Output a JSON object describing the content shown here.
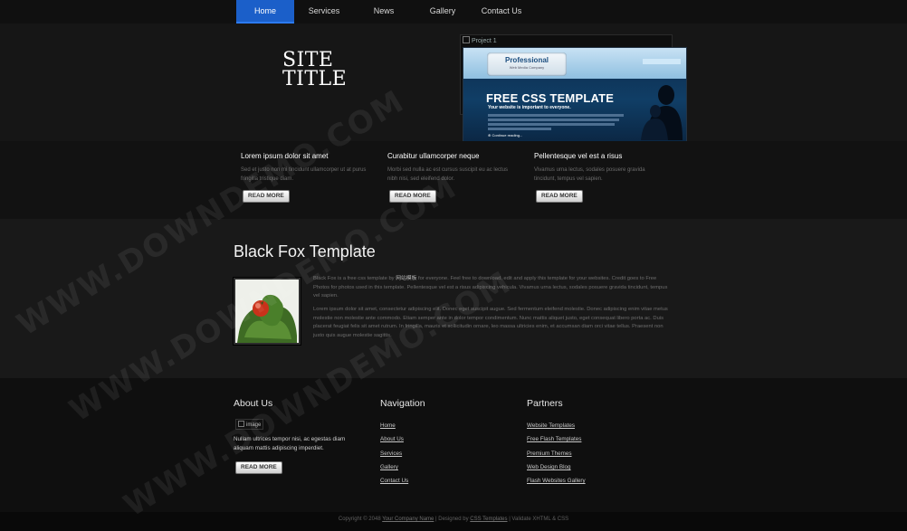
{
  "nav": {
    "items": [
      "Home",
      "Services",
      "News",
      "Gallery",
      "Contact Us"
    ],
    "active": "Home",
    "active_color": "#1b5fc9"
  },
  "header": {
    "site_title_line1": "SITE",
    "site_title_line2": "TITLE",
    "slider_alt": "Project 1",
    "slide": {
      "badge_title": "Professional",
      "badge_sub": "Web Media Company",
      "heading": "FREE CSS TEMPLATE",
      "sub": "Your website is important to everyone.",
      "cta": "Continue reading..."
    }
  },
  "features": [
    {
      "title": "Lorem ipsum dolor sit amet",
      "text": "Sed et justo non mi tincidunt ullamcorper ut at purus fringilla tristique diam.",
      "button": "READ MORE"
    },
    {
      "title": "Curabitur ullamcorper neque",
      "text": "Morbi sed nulla ac est cursus suscipit eu ac lectus nibh nisi, sed eleifend dolor.",
      "button": "READ MORE"
    },
    {
      "title": "Pellentesque vel est a risus",
      "text": "Vivamus urna lectus, sodales posuere gravida tincidunt, tempus vel sapien.",
      "button": "READ MORE"
    }
  ],
  "main": {
    "title": "Black Fox Template",
    "p1_before": "Black Fox is a free css template by ",
    "p1_link": "网站模板",
    "p1_after": " for everyone. Feel free to download, edit and apply this template for your websites. Credit goes to Free Photos for photos used in this template. Pellentesque vel est a risus adipiscing vehicula. Vivamus urna lectus, sodales posuere gravida tincidunt, tempus vel sapien.",
    "p2": "Lorem ipsum dolor sit amet, consectetur adipiscing elit. Donec eget suscipit augue. Sed fermentum eleifend molestie. Donec adipiscing enim vitae metus molestie non molestie ante commodo. Etiam semper ante in dolor tempor condimentum. Nunc mattis aliquet justo, eget consequat libero porta ac. Duis placerat feugiat felis sit amet rutrum. In fringilla, mauris et sollicitudin ornare, leo massa ultricies enim, et accumsan diam orci vitae tellus. Praesent non justo quis augue molestie sagittis."
  },
  "footer": {
    "about": {
      "heading": "About Us",
      "image_alt": "image",
      "text": "Nullam ultrices tempor nisi, ac egestas diam aliquam mattis adipiscing imperdiet.",
      "button": "READ MORE"
    },
    "navigation": {
      "heading": "Navigation",
      "links": [
        "Home",
        "About Us",
        "Services",
        "Gallery",
        "Contact Us"
      ]
    },
    "partners": {
      "heading": "Partners",
      "links": [
        "Website Templates",
        "Free Flash Templates",
        "Premium Themes",
        "Web Design Blog",
        "Flash Websites Gallery"
      ]
    }
  },
  "copyright": {
    "prefix": "Copyright © 2048 ",
    "company": "Your Company Name",
    "designed_by": " | Designed by ",
    "designer": "CSS Templates",
    "validate": " | Validate XHTML & CSS"
  },
  "watermark": "WWW.DOWNDEMO.COM"
}
